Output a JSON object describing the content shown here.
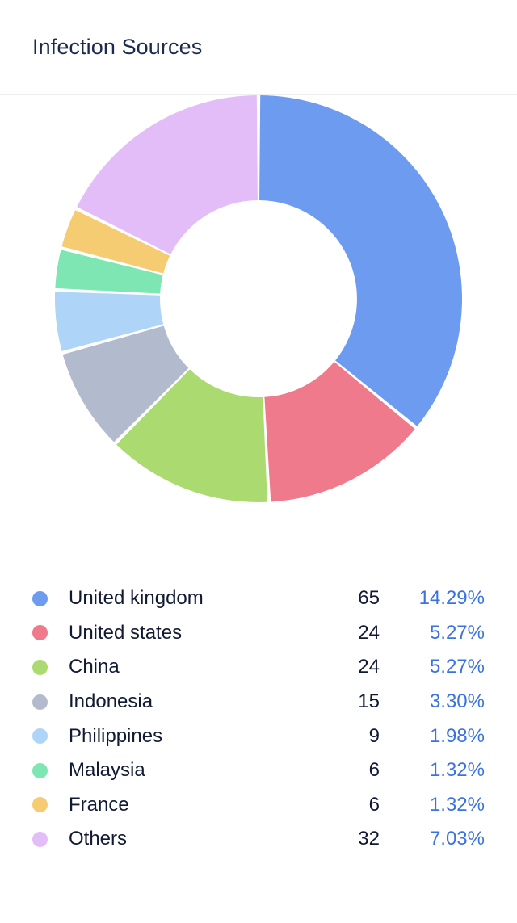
{
  "header": {
    "title": "Infection Sources"
  },
  "legend": {
    "rows": [
      {
        "label": "United kingdom",
        "value": "65",
        "percent": "14.29%",
        "color": "#6d9bef"
      },
      {
        "label": "United states",
        "value": "24",
        "percent": "5.27%",
        "color": "#ef7a8b"
      },
      {
        "label": "China",
        "value": "24",
        "percent": "5.27%",
        "color": "#aada70"
      },
      {
        "label": "Indonesia",
        "value": "15",
        "percent": "3.30%",
        "color": "#b2bacd"
      },
      {
        "label": "Philippines",
        "value": "9",
        "percent": "1.98%",
        "color": "#aed4f8"
      },
      {
        "label": "Malaysia",
        "value": "6",
        "percent": "1.32%",
        "color": "#7de6b2"
      },
      {
        "label": "France",
        "value": "6",
        "percent": "1.32%",
        "color": "#f6cc72"
      },
      {
        "label": "Others",
        "value": "32",
        "percent": "7.03%",
        "color": "#e3bdf7"
      }
    ]
  },
  "colors": {
    "title_text": "#1c2a4e",
    "value_text": "#111a33",
    "percent_text": "#3a72e0",
    "divider": "#eceef3",
    "background": "#ffffff"
  },
  "chart_data": {
    "type": "pie",
    "variant": "donut",
    "title": "Infection Sources",
    "legend_position": "bottom",
    "start_angle_deg": 0,
    "direction": "clockwise",
    "inner_radius_ratio": 0.484,
    "categories": [
      "United kingdom",
      "United states",
      "China",
      "Indonesia",
      "Philippines",
      "Malaysia",
      "France",
      "Others"
    ],
    "values": [
      65,
      24,
      24,
      15,
      9,
      6,
      6,
      32
    ],
    "percent_labels": [
      "14.29%",
      "5.27%",
      "5.27%",
      "3.30%",
      "1.98%",
      "1.32%",
      "1.32%",
      "7.03%"
    ],
    "colors": [
      "#6d9bef",
      "#ef7a8b",
      "#aada70",
      "#b2bacd",
      "#aed4f8",
      "#7de6b2",
      "#f6cc72",
      "#e3bdf7"
    ],
    "slice_total_drawn": 181,
    "grid": false
  }
}
